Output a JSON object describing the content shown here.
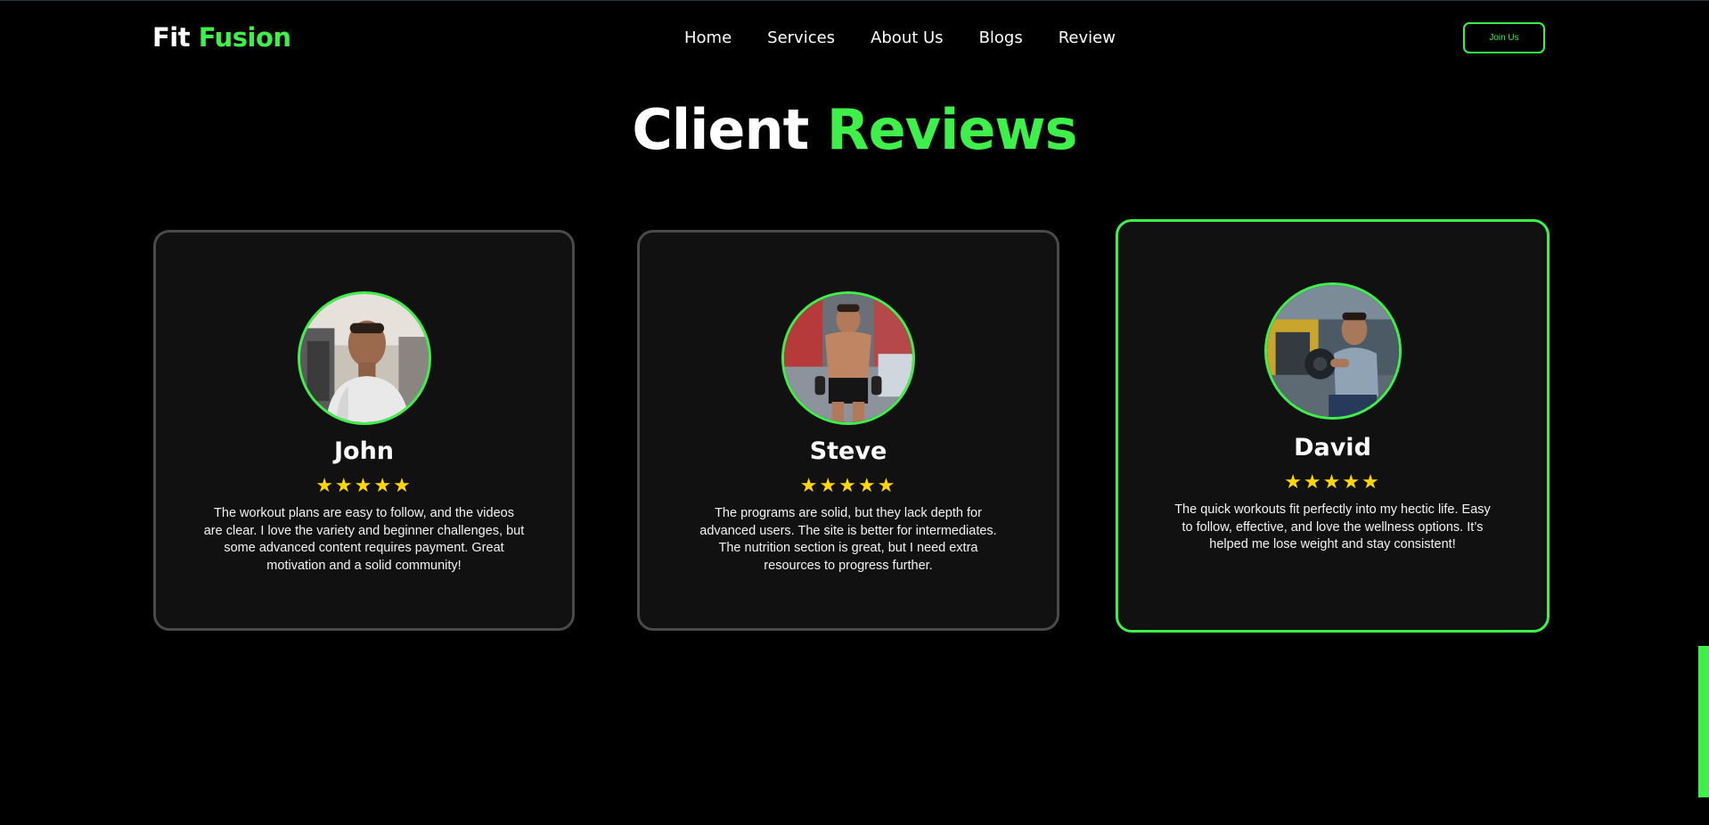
{
  "header": {
    "logo_primary": "Fit",
    "logo_accent": "Fusion",
    "nav": [
      {
        "label": "Home"
      },
      {
        "label": "Services"
      },
      {
        "label": "About Us"
      },
      {
        "label": "Blogs"
      },
      {
        "label": "Review"
      }
    ],
    "join_label": "Join Us"
  },
  "section": {
    "title_primary": "Client",
    "title_accent": "Reviews"
  },
  "reviews": [
    {
      "name": "John",
      "rating": 5,
      "stars": "★★★★★",
      "text": "The workout plans are easy to follow, and the videos are clear. I love the variety and beginner challenges, but some advanced content requires payment. Great motivation and a solid community!"
    },
    {
      "name": "Steve",
      "rating": 5,
      "stars": "★★★★★",
      "text": "The programs are solid, but they lack depth for advanced users. The site is better for intermediates. The nutrition section is great, but I need extra resources to progress further."
    },
    {
      "name": "David",
      "rating": 5,
      "stars": "★★★★★",
      "text": "The quick workouts fit perfectly into my hectic life. Easy to follow, effective, and love the wellness options. It’s helped me lose weight and stay consistent!"
    }
  ],
  "colors": {
    "accent": "#3ff04a",
    "background": "#000000",
    "card": "#111111",
    "card_border": "#4a4a4a",
    "star": "#ffd700"
  }
}
